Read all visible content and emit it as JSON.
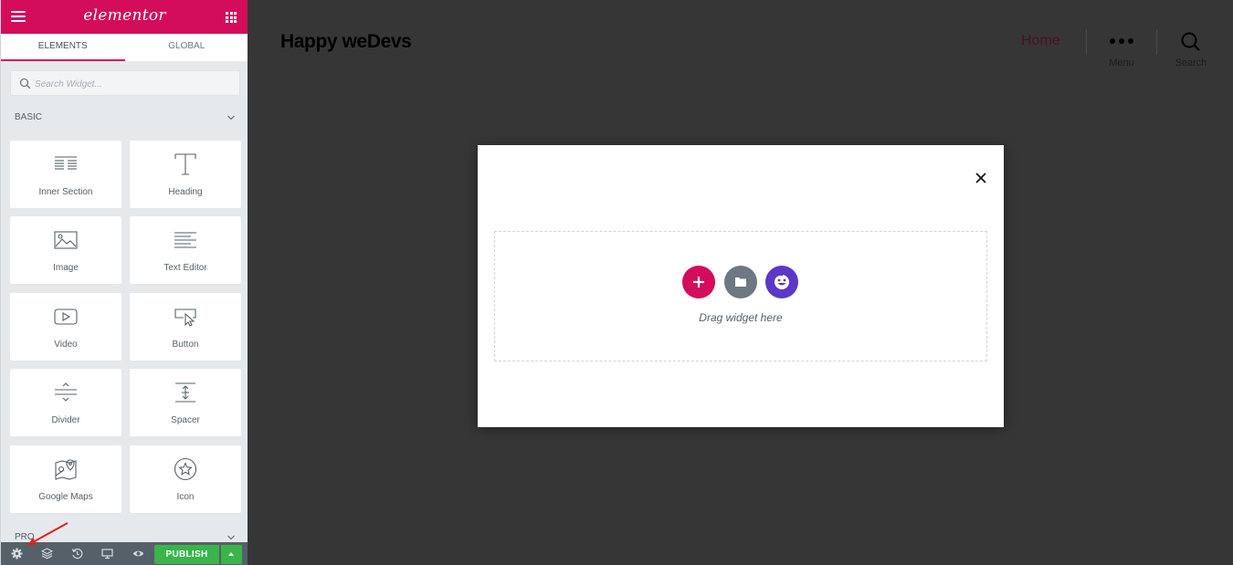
{
  "panel": {
    "logo": "elementor",
    "tabs": [
      {
        "label": "ELEMENTS",
        "active": true
      },
      {
        "label": "GLOBAL",
        "active": false
      }
    ],
    "search_placeholder": "Search Widget...",
    "category_basic": "BASIC",
    "category_pro_partial": "PRO",
    "widgets": [
      {
        "label": "Inner Section",
        "icon": "inner-section-icon"
      },
      {
        "label": "Heading",
        "icon": "heading-icon"
      },
      {
        "label": "Image",
        "icon": "image-icon"
      },
      {
        "label": "Text Editor",
        "icon": "text-editor-icon"
      },
      {
        "label": "Video",
        "icon": "video-icon"
      },
      {
        "label": "Button",
        "icon": "button-icon"
      },
      {
        "label": "Divider",
        "icon": "divider-icon"
      },
      {
        "label": "Spacer",
        "icon": "spacer-icon"
      },
      {
        "label": "Google Maps",
        "icon": "google-maps-icon"
      },
      {
        "label": "Icon",
        "icon": "star-icon"
      }
    ],
    "footer": {
      "publish_label": "PUBLISH",
      "icons": [
        "settings-icon",
        "navigator-icon",
        "history-icon",
        "responsive-icon",
        "preview-icon"
      ]
    }
  },
  "preview": {
    "site_title": "Happy weDevs",
    "nav": {
      "home": "Home",
      "menu": "Menu",
      "search": "Search"
    },
    "modal": {
      "drag_text": "Drag widget here",
      "buttons": [
        "add-section-icon",
        "template-library-icon",
        "happy-addons-icon"
      ]
    }
  },
  "colors": {
    "brand": "#d30c5c",
    "publish": "#39b54a",
    "canvas": "#363636",
    "footer": "#556068",
    "folder_button": "#6d7882",
    "happy_button": "#5b38c8"
  }
}
